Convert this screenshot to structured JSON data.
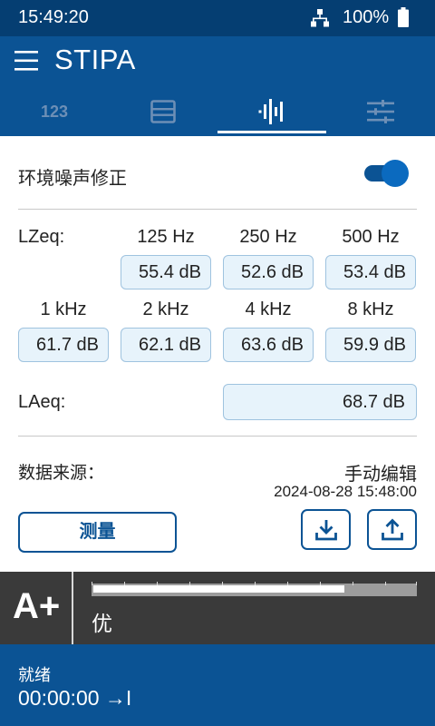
{
  "status_bar": {
    "time": "15:49:20",
    "battery": "100%",
    "network_icon": "network-icon",
    "battery_icon": "battery-icon"
  },
  "app_bar": {
    "title": "STIPA",
    "menu_icon": "menu-icon"
  },
  "tabs": [
    {
      "name": "numeric",
      "label": "123",
      "selected": false
    },
    {
      "name": "table",
      "icon": "table-icon",
      "selected": false
    },
    {
      "name": "spectrum",
      "icon": "spectrum-icon",
      "selected": true
    },
    {
      "name": "settings",
      "icon": "sliders-icon",
      "selected": false
    }
  ],
  "ambient_correction": {
    "label": "环境噪声修正",
    "enabled": true
  },
  "lzeq": {
    "label": "LZeq:",
    "bands": [
      {
        "freq": "125 Hz",
        "value": "55.4 dB"
      },
      {
        "freq": "250 Hz",
        "value": "52.6 dB"
      },
      {
        "freq": "500 Hz",
        "value": "53.4 dB"
      },
      {
        "freq": "1 kHz",
        "value": "61.7 dB"
      },
      {
        "freq": "2 kHz",
        "value": "62.1 dB"
      },
      {
        "freq": "4 kHz",
        "value": "63.6 dB"
      },
      {
        "freq": "8 kHz",
        "value": "59.9 dB"
      }
    ]
  },
  "laeq": {
    "label": "LAeq:",
    "value": "68.7 dB"
  },
  "data_source": {
    "label": "数据来源：",
    "value": "手动编辑",
    "timestamp": "2024-08-28 15:48:00"
  },
  "actions": {
    "measure_label": "测量",
    "download_icon": "download-icon",
    "upload_icon": "upload-icon"
  },
  "rating": {
    "grade": "A+",
    "word": "优",
    "level_fraction": 0.78
  },
  "bottom": {
    "state": "就绪",
    "timer": "00:00:00 →I"
  },
  "colors": {
    "primary": "#0b5394",
    "status_bar": "#053e72",
    "box_fill": "#e7f3fb",
    "box_border": "#9fc3df",
    "rating_bg": "#3a3a3a"
  }
}
